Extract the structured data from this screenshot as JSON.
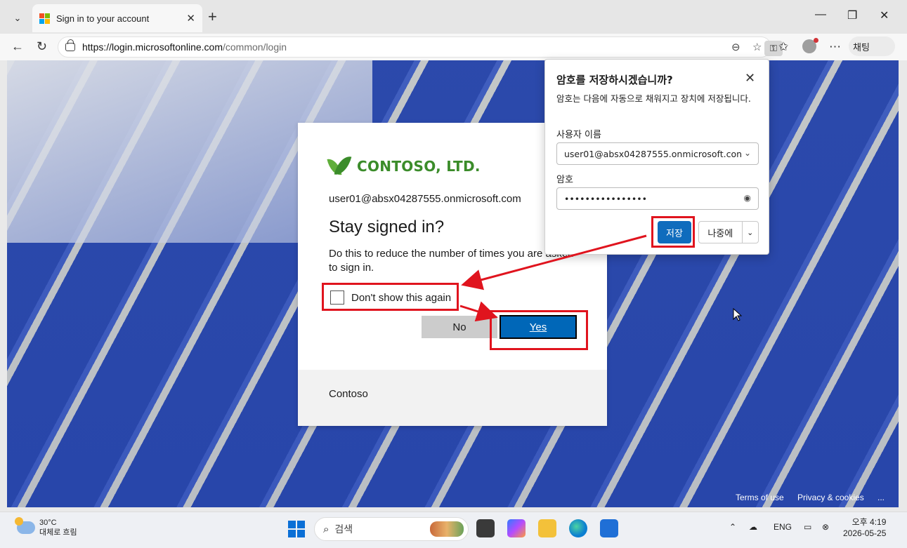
{
  "browser": {
    "tab_title": "Sign in to your account",
    "url_host": "https://login.microsoftonline.com",
    "url_path": "/common/login",
    "copilot_label": "채팅"
  },
  "signin": {
    "logo_text": "CONTOSO, LTD.",
    "email": "user01@absx04287555.onmicrosoft.com",
    "heading": "Stay signed in?",
    "description": "Do this to reduce the number of times you are asked to sign in.",
    "checkbox_label": "Don't show this again",
    "no_label": "No",
    "yes_label": "Yes",
    "footer_text": "Contoso"
  },
  "page_footer": {
    "terms": "Terms of use",
    "privacy": "Privacy & cookies",
    "more": "..."
  },
  "save_password_popup": {
    "title": "암호를 저장하시겠습니까?",
    "description": "암호는 다음에 자동으로 채워지고 장치에 저장됩니다.",
    "username_label": "사용자 이름",
    "username_value": "user01@absx04287555.onmicrosoft.con",
    "password_label": "암호",
    "password_value": "••••••••••••••••",
    "save_label": "저장",
    "later_label": "나중에"
  },
  "taskbar": {
    "temperature": "30°C",
    "weather": "대체로 흐림",
    "search_placeholder": "검색",
    "language": "ENG",
    "time": "오후 4:19",
    "date": "2026-05-25"
  },
  "colors": {
    "annotation": "#e0141e",
    "yes_button": "#0067b8",
    "save_button": "#0f6cbd",
    "logo_green": "#3b8c2a"
  }
}
